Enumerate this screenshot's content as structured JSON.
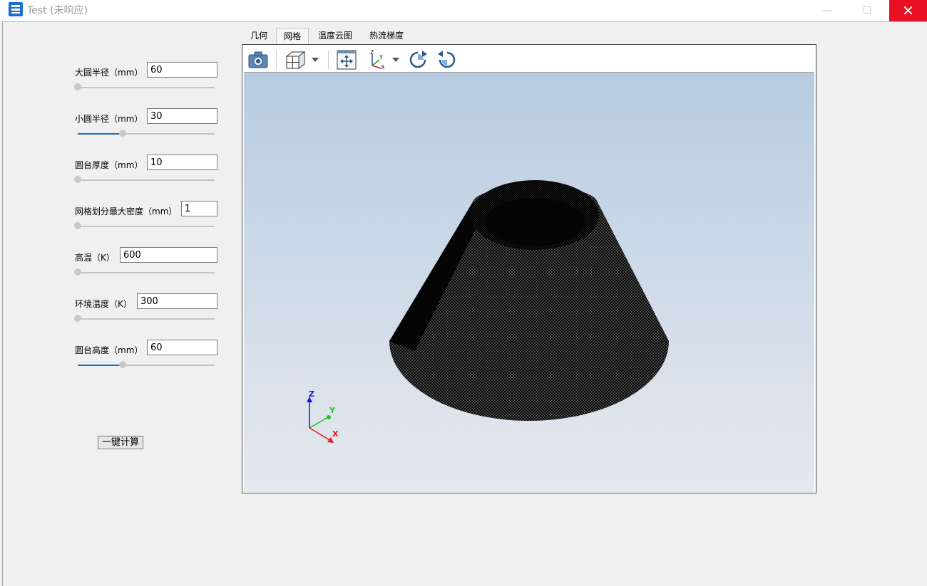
{
  "window": {
    "title": "Test (未响应)",
    "controls": {
      "minimize": "—",
      "maximize": "☐",
      "close": "✕"
    }
  },
  "params": [
    {
      "label": "大圆半径（mm）",
      "value": "60",
      "slider_fraction": 0.0
    },
    {
      "label": "小圆半径（mm）",
      "value": "30",
      "slider_fraction": 0.33
    },
    {
      "label": "圆台厚度（mm）",
      "value": "10",
      "slider_fraction": 0.0
    },
    {
      "label": "网格划分最大密度（mm）",
      "value": "1",
      "slider_fraction": 0.0
    },
    {
      "label": "高温（K）",
      "value": "600",
      "slider_fraction": 0.0
    },
    {
      "label": "环境温度（K）",
      "value": "300",
      "slider_fraction": 0.0
    },
    {
      "label": "圆台高度（mm）",
      "value": "60",
      "slider_fraction": 0.33
    }
  ],
  "calc_button": "一键计算",
  "tabs": [
    {
      "label": "几何",
      "active": false
    },
    {
      "label": "网格",
      "active": true
    },
    {
      "label": "温度云图",
      "active": false
    },
    {
      "label": "热流梯度",
      "active": false
    }
  ],
  "toolbar": {
    "icons": [
      "camera-icon",
      "cube-view-icon",
      "fit-view-icon",
      "axes-orientation-icon",
      "rotate-cw-icon",
      "rotate-ccw-icon"
    ]
  },
  "triad": {
    "x": "X",
    "y": "Y",
    "z": "Z",
    "x_color": "#e8181a",
    "y_color": "#1cc81c",
    "z_color": "#1515e0"
  },
  "colors": {
    "accent": "#1672c6",
    "close": "#e81123",
    "mesh": "#000000"
  }
}
